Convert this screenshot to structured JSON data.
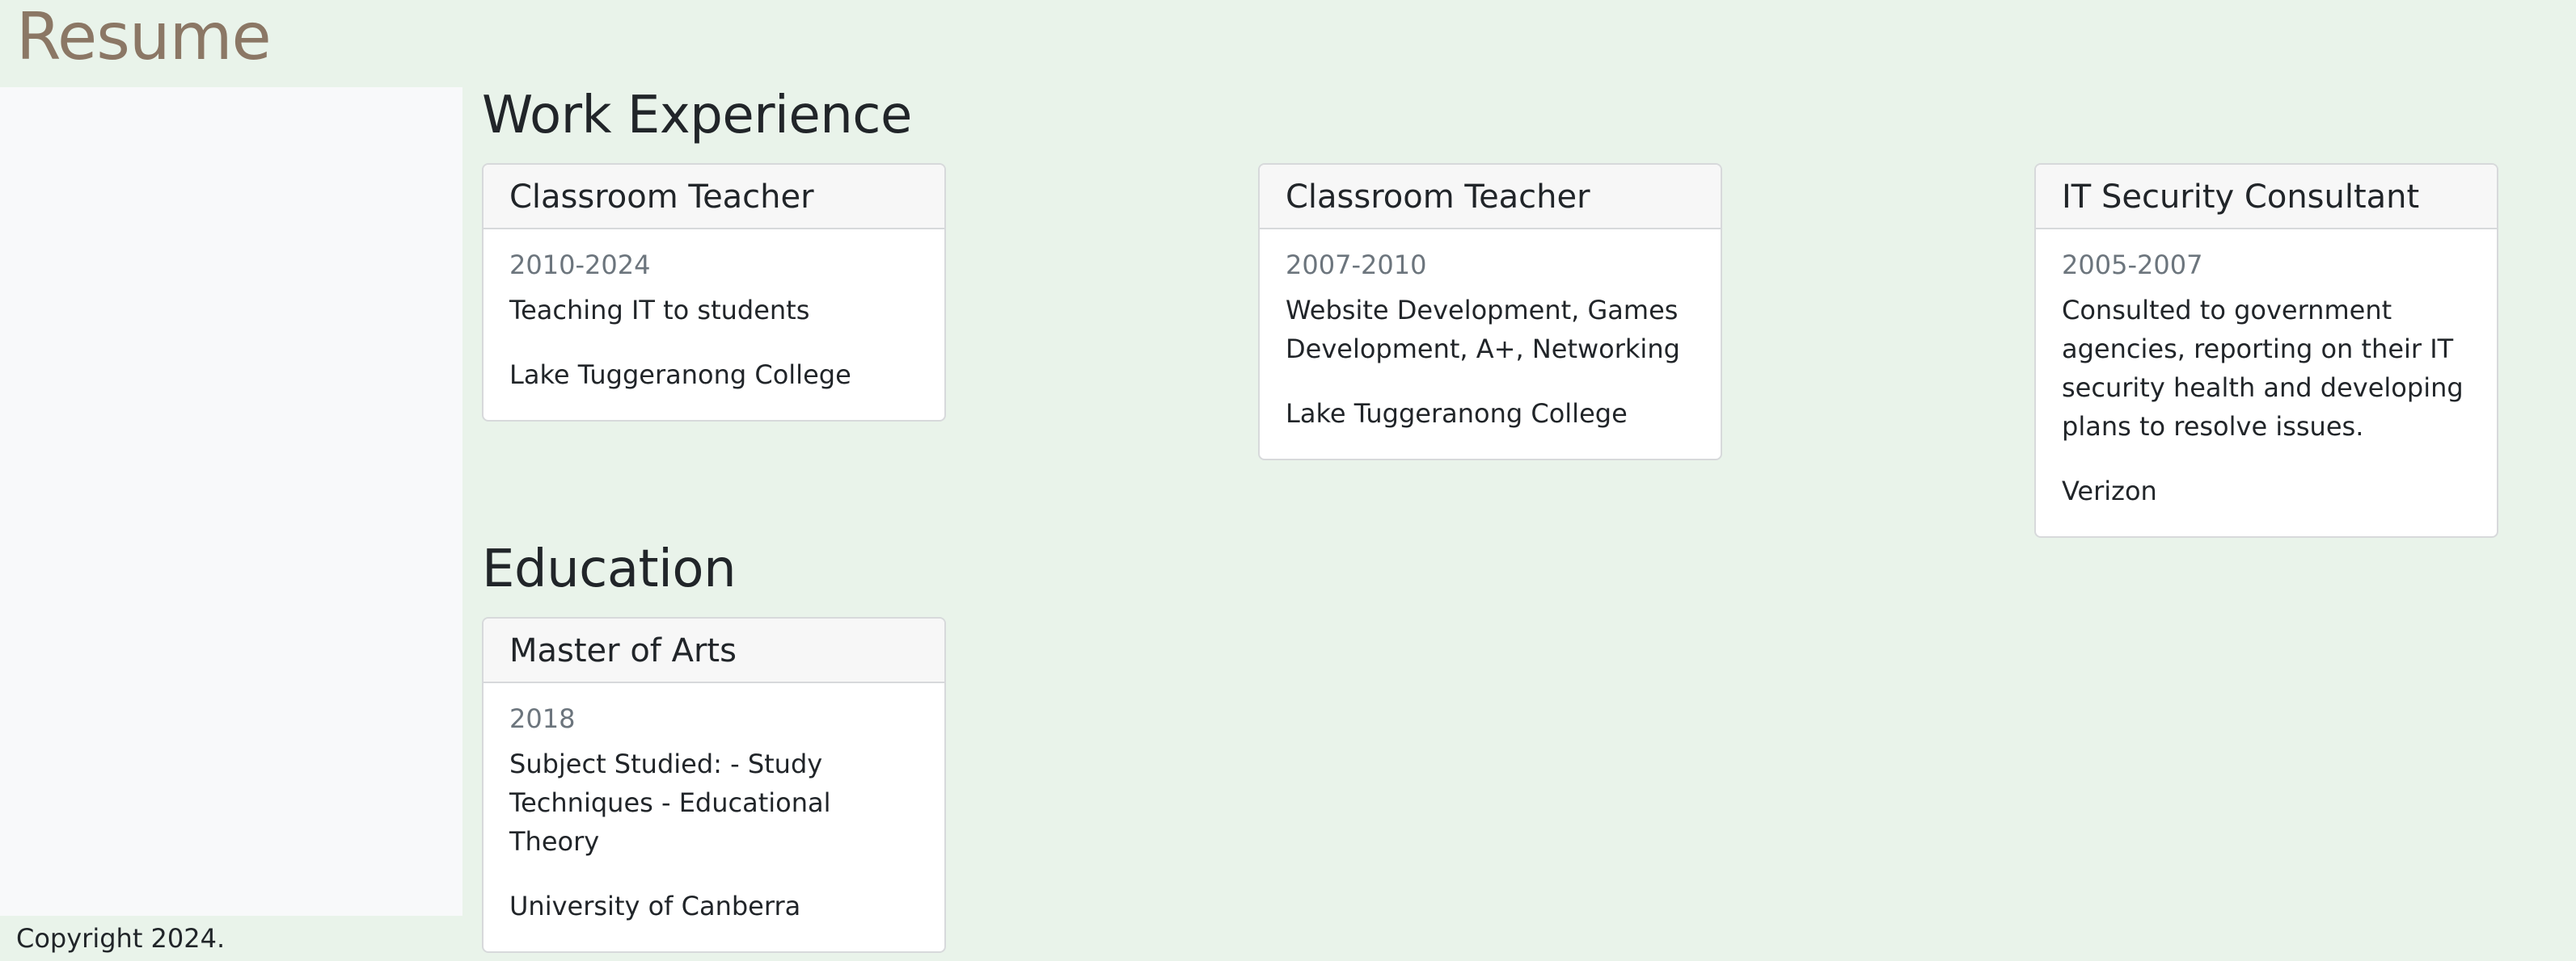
{
  "header": {
    "title": "Resume"
  },
  "work": {
    "heading": "Work Experience",
    "items": [
      {
        "title": "Classroom Teacher",
        "date": "2010-2024",
        "description": "Teaching IT to students",
        "organization": "Lake Tuggeranong College"
      },
      {
        "title": "Classroom Teacher",
        "date": "2007-2010",
        "description": "Website Development, Games Development, A+, Networking",
        "organization": "Lake Tuggeranong College"
      },
      {
        "title": "IT Security Consultant",
        "date": "2005-2007",
        "description": "Consulted to government agencies, reporting on their IT security health and developing plans to resolve issues.",
        "organization": "Verizon"
      }
    ]
  },
  "education": {
    "heading": "Education",
    "items": [
      {
        "title": "Master of Arts",
        "date": "2018",
        "description": "Subject Studied: - Study Techniques - Educational Theory",
        "organization": "University of Canberra"
      }
    ]
  },
  "footer": {
    "copyright": "Copyright 2024."
  },
  "colors": {
    "page_background": "#e9f3ea",
    "sidebar_background": "#f8f9fa",
    "title_color": "#8b7765",
    "muted_text": "#6c757d"
  }
}
